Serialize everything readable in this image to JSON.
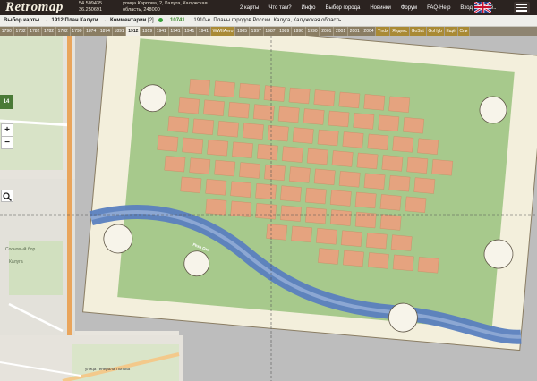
{
  "header": {
    "logo": "Retromap",
    "coords_lat": "54.509435",
    "coords_lon": "36.250691",
    "address": "улица Карпова, 2, Калуга, Калужская область, 248000",
    "nav": [
      "2 карты",
      "Что там?",
      "Инфо",
      "Выбор города",
      "Новинки",
      "Форум",
      "FAQ-Help",
      "Вход",
      "Ещё.."
    ],
    "flag_icon": "uk-flag-icon"
  },
  "breadcrumb": {
    "choose_map": "Выбор карты",
    "sep": "→",
    "map_title": "1912 План Калуги",
    "comments_label": "Комментарии",
    "comments_count": "[2]",
    "map_id": "10741",
    "description": "1910-е. Планы городов России. Калуга, Калужская область"
  },
  "years": [
    "1790",
    "1782",
    "1782",
    "1782",
    "1782",
    "1790",
    "1874",
    "1874",
    "1891",
    "1912",
    "1919",
    "1941",
    "1941",
    "1941",
    "1941",
    "WWIIAero",
    "1985",
    "1997",
    "1987",
    "1989",
    "1990",
    "1990",
    "2001",
    "2001",
    "2001",
    "2004",
    "Yndx",
    "Яндекс",
    "GoSat",
    "GoHyb",
    "Ещё",
    "Спи"
  ],
  "active_year_index": 9,
  "controls": {
    "layer_badge": "14",
    "zoom_in": "+",
    "zoom_out": "−"
  },
  "map_labels": {
    "river": "Река Ока",
    "osm_city": "Сосновый бор",
    "osm_kaluga": "Калуга",
    "osm_street": "улица Генерала Попова"
  },
  "colors": {
    "header_bg": "#2b2320",
    "year_tab_bg": "#8a7d63",
    "active_tab_bg": "#f2efe6",
    "river": "#5a7fbf",
    "old_map_paper": "#f3efdc",
    "blocks_orange": "#e5a37f",
    "blocks_green": "#7ea860",
    "osm_road": "#e9a55c"
  }
}
